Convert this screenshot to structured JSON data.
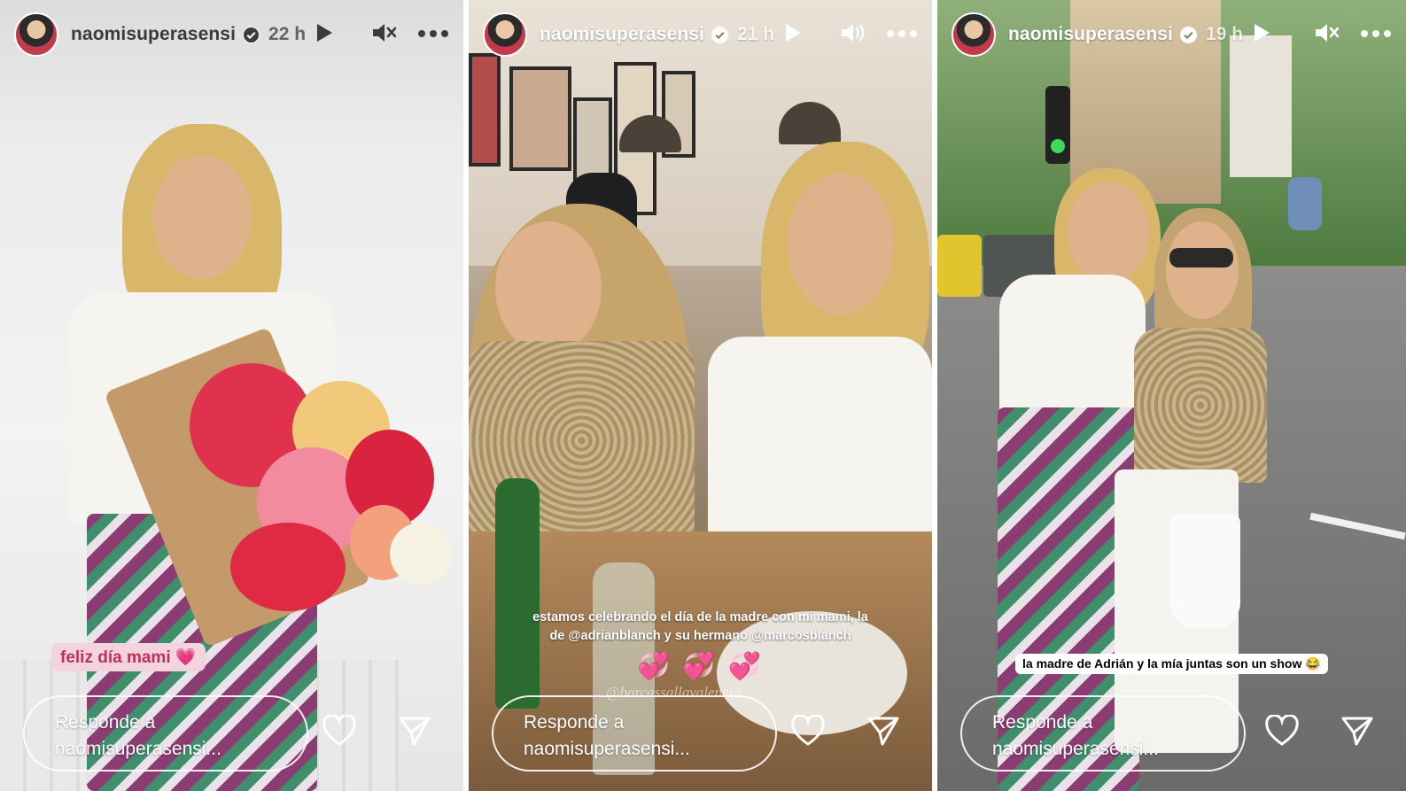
{
  "stories": [
    {
      "username": "naomisuperasensi",
      "time": "22 h",
      "sound_icon": "muted-speaker-icon",
      "caption": "feliz día mami 💗",
      "reply_line1": "Responde a",
      "reply_line2": "naomisuperasensi..."
    },
    {
      "username": "naomisuperasensi",
      "time": "21 h",
      "sound_icon": "speaker-icon",
      "caption_line1": "estamos celebrando el día de la madre con mi mami, la",
      "caption_line2": "de @adrianblanch y su hermano @marcosblanch",
      "hearts": "💞💞💞",
      "mention": "@barcassallavalencia",
      "reply_line1": "Responde a",
      "reply_line2": "naomisuperasensi..."
    },
    {
      "username": "naomisuperasensi",
      "time": "19 h",
      "sound_icon": "muted-speaker-icon",
      "caption": "la madre de Adrián y la mía juntas son un show 😂",
      "reply_line1": "Responde a",
      "reply_line2": "naomisuperasensi..."
    }
  ],
  "colors": {
    "caption_pink_bg": "#f2d3de",
    "caption_pink_text": "#c0305a",
    "heart_magenta": "#d6338f"
  }
}
